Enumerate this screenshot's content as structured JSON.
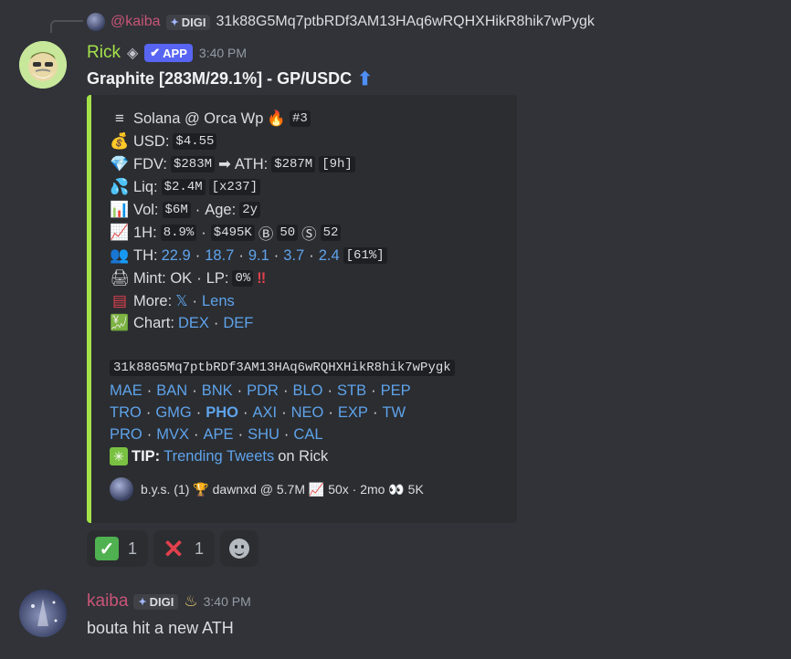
{
  "reply": {
    "username": "@kaiba",
    "tag": "DIGI",
    "text": "31k88G5Mq7ptbRDf3AM13HAq6wRQHXHikR8hik7wPygk"
  },
  "message1": {
    "username": "Rick",
    "app_badge": "APP",
    "timestamp": "3:40 PM",
    "title": "Graphite [283M/29.1%] - GP/USDC",
    "embed": {
      "line1": {
        "text": "Solana @ Orca Wp",
        "rank": "#3"
      },
      "usd": {
        "label": "USD:",
        "value": "$4.55"
      },
      "fdv": {
        "label": "FDV:",
        "value": "$283M",
        "ath_label": "ATH:",
        "ath_value": "$287M",
        "ath_age": "[9h]"
      },
      "liq": {
        "label": "Liq:",
        "value": "$2.4M",
        "mult": "[x237]"
      },
      "vol": {
        "label": "Vol:",
        "value": "$6M",
        "age_label": "Age:",
        "age_value": "2y"
      },
      "onehour": {
        "label": "1H:",
        "pct": "8.9%",
        "usd": "$495K",
        "buys": "50",
        "sells": "52"
      },
      "th": {
        "label": "TH:",
        "values": [
          "22.9",
          "18.7",
          "9.1",
          "3.7",
          "2.4"
        ],
        "total": "[61%]"
      },
      "mint": {
        "label": "Mint: OK",
        "lp_label": "LP:",
        "lp_value": "0%"
      },
      "more": {
        "label": "More:",
        "x": "𝕏",
        "lens": "Lens"
      },
      "chart": {
        "label": "Chart:",
        "dex": "DEX",
        "def": "DEF"
      },
      "ca": "31k88G5Mq7ptbRDf3AM13HAq6wRQHXHikR8hik7wPygk",
      "bots_row1": [
        "MAE",
        "BAN",
        "BNK",
        "PDR",
        "BLO",
        "STB",
        "PEP"
      ],
      "bots_row2": [
        "TRO",
        "GMG",
        "PHO",
        "AXI",
        "NEO",
        "EXP",
        "TW"
      ],
      "bots_row3": [
        "PRO",
        "MVX",
        "APE",
        "SHU",
        "CAL"
      ],
      "tip": {
        "label": "TIP:",
        "link": "Trending Tweets",
        "suffix": "on Rick"
      },
      "footer": "b.y.s. (1) 🏆 dawnxd @ 5.7M 📈 50x · 2mo 👀 5K"
    },
    "reactions": [
      {
        "emoji": "check",
        "count": "1"
      },
      {
        "emoji": "cross",
        "count": "1"
      }
    ]
  },
  "message2": {
    "username": "kaiba",
    "tag": "DIGI",
    "timestamp": "3:40 PM",
    "text": "bouta hit a new ATH"
  },
  "colors": {
    "background": "#313338",
    "embed_bg": "#2b2d31",
    "embed_accent": "#a4e24a",
    "link": "#5fa3ea",
    "rick": "#a4e24a",
    "kaiba": "#c95576",
    "app_badge": "#5865f2"
  }
}
